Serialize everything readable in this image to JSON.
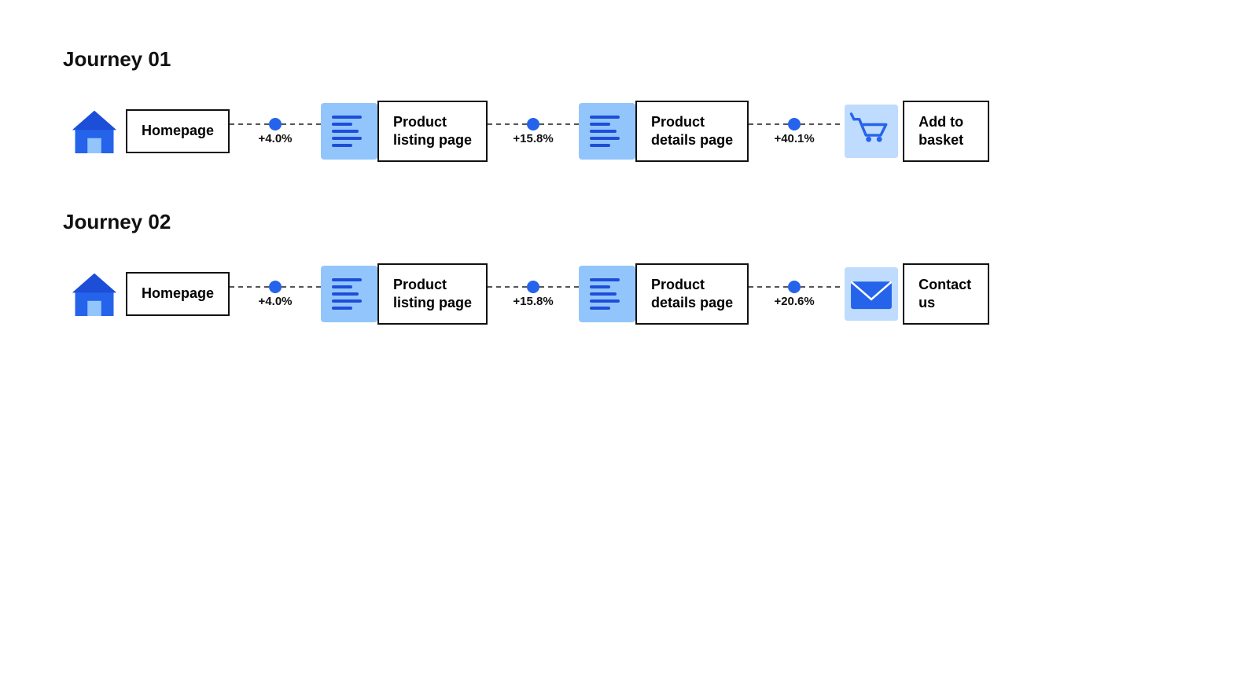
{
  "journey1": {
    "title": "Journey 01",
    "nodes": [
      {
        "id": "homepage1",
        "label": "Homepage",
        "icon": "home"
      },
      {
        "id": "product-listing1",
        "label": "Product\nlisting page",
        "icon": "list"
      },
      {
        "id": "product-details1",
        "label": "Product\ndetails page",
        "icon": "list"
      },
      {
        "id": "add-to-basket1",
        "label": "Add to\nbasket",
        "icon": "cart"
      }
    ],
    "connectors": [
      {
        "label": "+4.0%"
      },
      {
        "label": "+15.8%"
      },
      {
        "label": "+40.1%"
      }
    ]
  },
  "journey2": {
    "title": "Journey 02",
    "nodes": [
      {
        "id": "homepage2",
        "label": "Homepage",
        "icon": "home"
      },
      {
        "id": "product-listing2",
        "label": "Product\nlisting page",
        "icon": "list"
      },
      {
        "id": "product-details2",
        "label": "Product\ndetails page",
        "icon": "list"
      },
      {
        "id": "contact-us2",
        "label": "Contact\nus",
        "icon": "mail"
      }
    ],
    "connectors": [
      {
        "label": "+4.0%"
      },
      {
        "label": "+15.8%"
      },
      {
        "label": "+20.6%"
      }
    ]
  }
}
